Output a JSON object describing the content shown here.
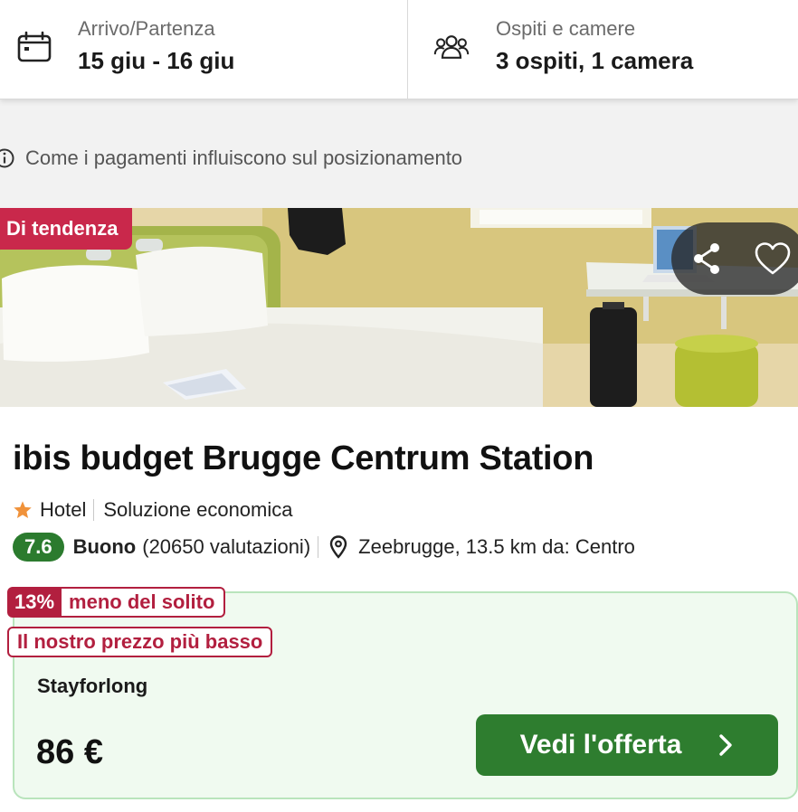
{
  "search": {
    "dates_label": "Arrivo/Partenza",
    "dates_value": "15 giu - 16 giu",
    "guests_label": "Ospiti e camere",
    "guests_value": "3 ospiti, 1 camera",
    "dates_icon": "calendar-icon",
    "guests_icon": "people-icon"
  },
  "info": {
    "text": "Come i pagamenti influiscono sul posizionamento",
    "icon": "info-icon"
  },
  "listing": {
    "badge": "Di tendenza",
    "share_icon": "share-icon",
    "favorite_icon": "heart-icon",
    "title": "ibis budget Brugge Centrum Station",
    "type": "Hotel",
    "category": "Soluzione economica",
    "score": "7.6",
    "rating_word": "Buono",
    "reviews": "(20650 valutazioni)",
    "location": "Zeebrugge, 13.5 km da: Centro"
  },
  "deal": {
    "savings_percent": "13%",
    "savings_text": "meno del solito",
    "lowest_price_label": "Il nostro prezzo più basso",
    "provider": "Stayforlong",
    "price": "86 €",
    "cta_label": "Vedi l'offerta"
  },
  "colors": {
    "badge_red": "#c9284b",
    "savings_red": "#b21f3f",
    "score_green": "#2b7b2e",
    "cta_green": "#2e7d2f",
    "deal_bg": "#f0faf0",
    "deal_border": "#b9e4bc",
    "star_orange": "#f0923a"
  }
}
